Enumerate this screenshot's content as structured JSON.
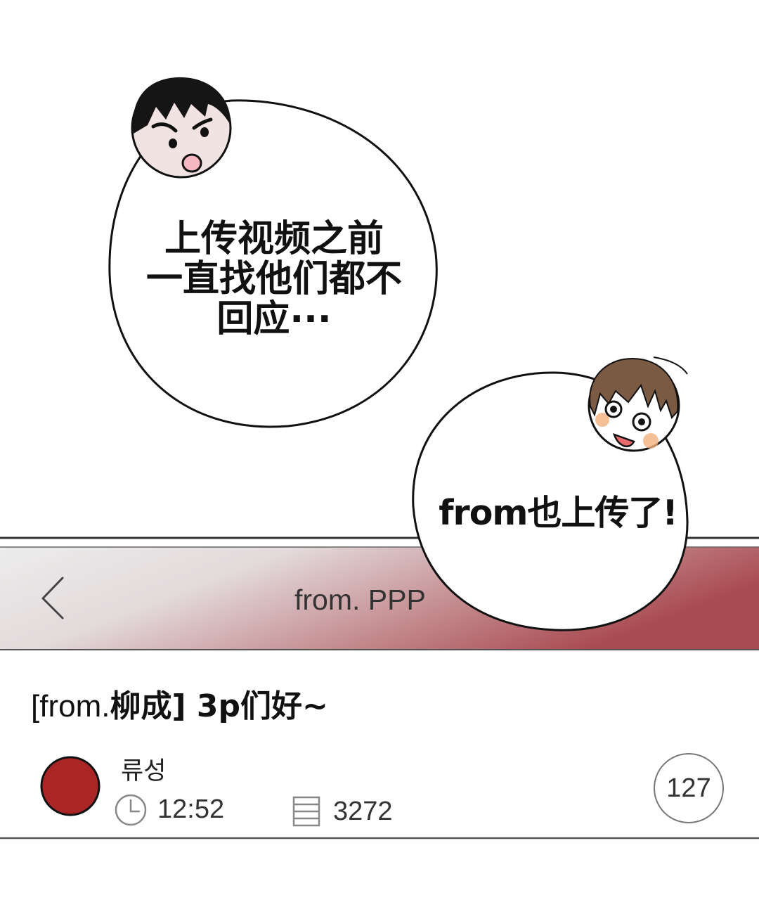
{
  "speech_bubbles": [
    {
      "speaker": "dark-haired boy",
      "lines": [
        "上传视频之前",
        "一直找他们都不",
        "回应···"
      ]
    },
    {
      "speaker": "brown-haired boy",
      "lines": [
        "from也上传了!"
      ]
    }
  ],
  "app_screen": {
    "nav": {
      "back_icon": "chevron-left-icon",
      "title": "from. PPP"
    },
    "post": {
      "title_prefix": "[from.",
      "title_main": "柳成]",
      "title_rest": " 3p们好~",
      "author": "류성",
      "time_icon": "clock-icon",
      "time": "12:52",
      "views_icon": "document-lines-icon",
      "views": "3272",
      "comments": "127"
    },
    "colors": {
      "header_gradient_start": "#ececec",
      "header_gradient_end": "#a94c52",
      "avatar": "#aa2626",
      "skin_pale": "#f1e3e1",
      "mouth_pink": "#f5b8c0",
      "cheek_blush": "#f2b07d"
    }
  }
}
